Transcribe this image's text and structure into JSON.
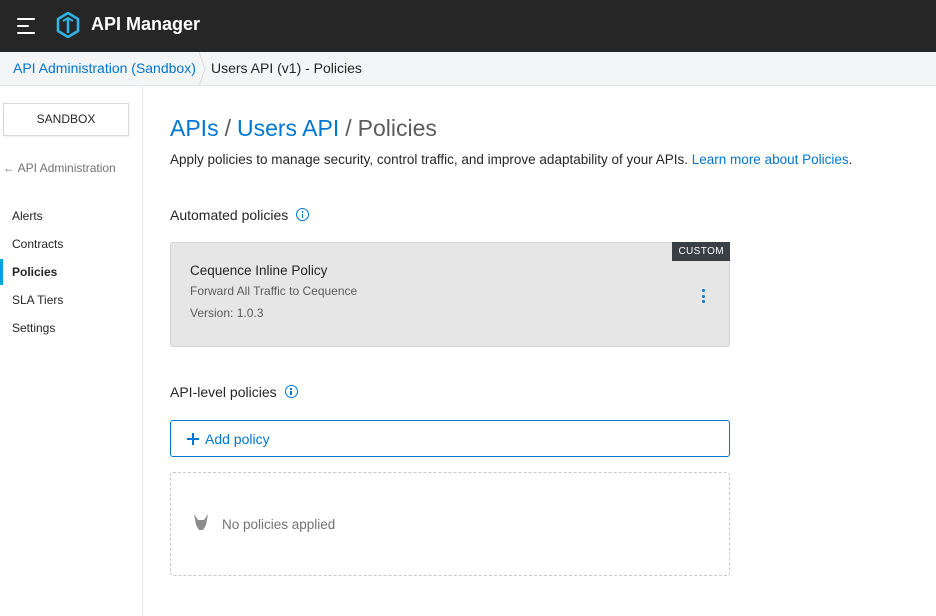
{
  "app": {
    "title": "API Manager"
  },
  "breadcrumb": {
    "link": "API Administration (Sandbox)",
    "current": "Users API (v1) - Policies"
  },
  "sidebar": {
    "environment_button": "SANDBOX",
    "back_link": "API Administration",
    "items": [
      {
        "label": "Alerts",
        "active": false
      },
      {
        "label": "Contracts",
        "active": false
      },
      {
        "label": "Policies",
        "active": true
      },
      {
        "label": "SLA Tiers",
        "active": false
      },
      {
        "label": "Settings",
        "active": false
      }
    ]
  },
  "page": {
    "title_parts": [
      "APIs",
      "Users API",
      "Policies"
    ],
    "separator": "/",
    "description": "Apply policies to manage security, control traffic, and improve adaptability of your APIs.",
    "learn_more": "Learn more about Policies",
    "description_end": "."
  },
  "automated": {
    "label": "Automated policies",
    "policy": {
      "badge": "CUSTOM",
      "name": "Cequence Inline Policy",
      "description": "Forward All Traffic to Cequence",
      "version": "Version: 1.0.3"
    }
  },
  "api_level": {
    "label": "API-level policies",
    "add_button": "Add policy",
    "empty_text": "No policies applied"
  },
  "icons": {
    "menu": "hamburger-menu-icon",
    "logo": "api-manager-logo-icon",
    "info": "info-icon",
    "more": "more-vertical-icon",
    "add": "plus-icon",
    "empty": "empty-state-icon",
    "back": "arrow-left-icon"
  },
  "colors": {
    "accent": "#0176d3",
    "topbar": "#262626",
    "active_nav": "#00a2df",
    "badge": "#3a3f45"
  }
}
